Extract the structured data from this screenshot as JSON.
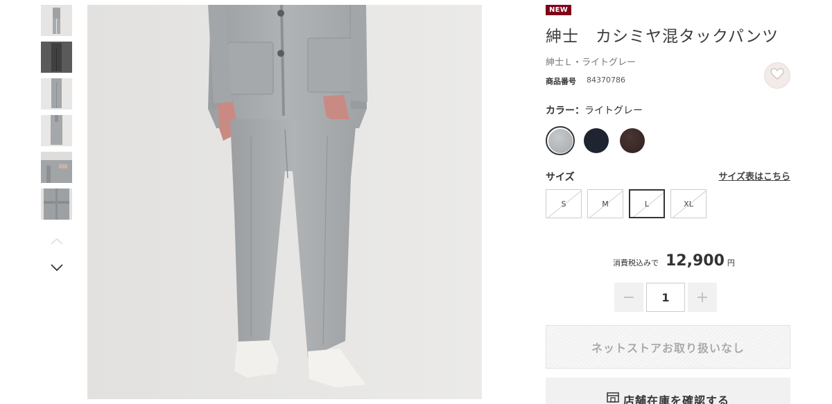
{
  "gallery": {
    "thumb_count": 6,
    "prev_icon": "chevron-up-icon",
    "next_icon": "chevron-down-icon"
  },
  "product": {
    "badge": "NEW",
    "title": "紳士　カシミヤ混タックパンツ",
    "subtitle": "紳士Ｌ・ライトグレー",
    "number_label": "商品番号",
    "number_value": "84370786",
    "favorite_icon": "heart-icon"
  },
  "color": {
    "label": "カラー：",
    "value": "ライトグレー",
    "swatches": [
      {
        "name": "light-gray",
        "hex": "#b4b8bb",
        "selected": true
      },
      {
        "name": "navy",
        "hex": "#1e2530",
        "selected": false
      },
      {
        "name": "dark-brown",
        "hex": "#3a2a27",
        "selected": false
      }
    ]
  },
  "size": {
    "label": "サイズ",
    "guide_link": "サイズ表はこちら",
    "options": [
      {
        "label": "S",
        "selected": false
      },
      {
        "label": "M",
        "selected": false
      },
      {
        "label": "L",
        "selected": true
      },
      {
        "label": "XL",
        "selected": false
      }
    ]
  },
  "price": {
    "note": "消費税込みで",
    "value": "12,900",
    "unit": "円"
  },
  "quantity": {
    "value": "1",
    "minus": "−",
    "plus": "+"
  },
  "buttons": {
    "cart": "ネットストアお取り扱いなし",
    "store": "店舗在庫を確認する"
  },
  "colors": {
    "badge_bg": "#7f0019",
    "main_image_bg": "#e7e6e4"
  }
}
